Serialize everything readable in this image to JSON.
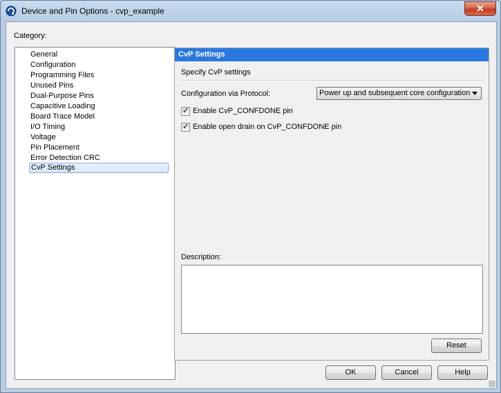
{
  "window": {
    "title": "Device and Pin Options - cvp_example",
    "close_glyph": "✕"
  },
  "category": {
    "label": "Category:",
    "items": [
      "General",
      "Configuration",
      "Programming Files",
      "Unused Pins",
      "Dual-Purpose Pins",
      "Capacitive Loading",
      "Board Trace Model",
      "I/O Timing",
      "Voltage",
      "Pin Placement",
      "Error Detection CRC",
      "CvP Settings"
    ],
    "selected_index": 11
  },
  "panel": {
    "header": "CvP Settings",
    "subtitle": "Specify CvP settings",
    "protocol_label": "Configuration via Protocol:",
    "protocol_value": "Power up and subsequent core configuration",
    "checkboxes": [
      {
        "label": "Enable CvP_CONFDONE pin",
        "checked": true
      },
      {
        "label": "Enable open drain on CvP_CONFDONE pin",
        "checked": true
      }
    ],
    "description_label": "Description:",
    "description_value": "",
    "reset_label": "Reset"
  },
  "buttons": {
    "ok": "OK",
    "cancel": "Cancel",
    "help": "Help"
  },
  "icons": {
    "app": "quartus-app-icon",
    "check": "✓"
  },
  "colors": {
    "header_bg": "#2a77e0",
    "selection_border": "#84acdd",
    "close_button": "#c13a20"
  }
}
